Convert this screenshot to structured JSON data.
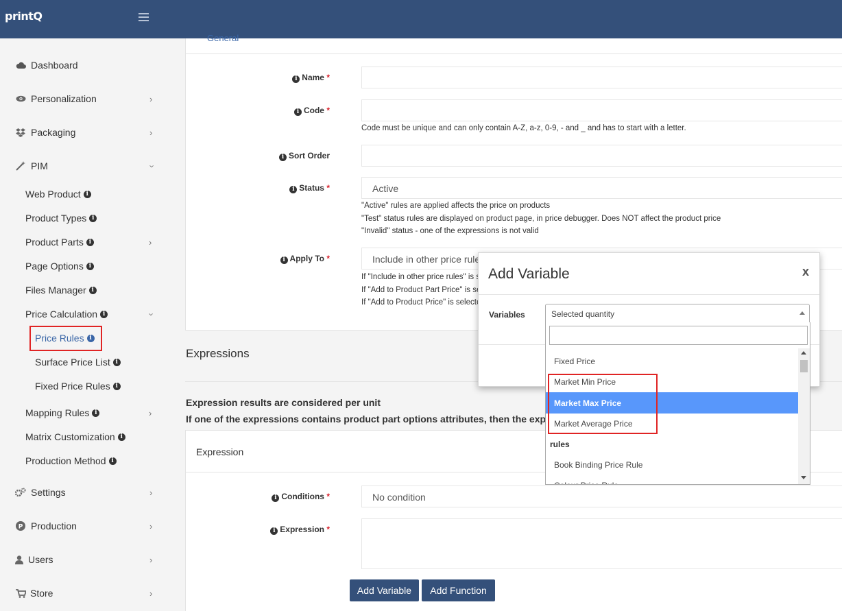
{
  "app": {
    "logo": "printQ"
  },
  "sidebar": {
    "items": [
      {
        "label": "Dashboard",
        "icon": "cloud-icon"
      },
      {
        "label": "Personalization",
        "icon": "eye-icon"
      },
      {
        "label": "Packaging",
        "icon": "dropbox-icon"
      },
      {
        "label": "PIM",
        "icon": "magic-wand-icon"
      },
      {
        "label": "Settings",
        "icon": "gears-icon"
      },
      {
        "label": "Production",
        "icon": "p-circle-icon"
      },
      {
        "label": "Users",
        "icon": "user-icon"
      },
      {
        "label": "Store",
        "icon": "cart-icon"
      }
    ],
    "pim_sub": [
      {
        "label": "Web Product"
      },
      {
        "label": "Product Types"
      },
      {
        "label": "Product Parts"
      },
      {
        "label": "Page Options"
      },
      {
        "label": "Files Manager"
      },
      {
        "label": "Price Calculation"
      },
      {
        "label": "Mapping Rules"
      },
      {
        "label": "Matrix Customization"
      },
      {
        "label": "Production Method"
      }
    ],
    "price_sub": [
      {
        "label": "Price Rules"
      },
      {
        "label": "Surface Price List"
      },
      {
        "label": "Fixed Price Rules"
      }
    ]
  },
  "form": {
    "tab_general": "General",
    "name_label": "Name",
    "code_label": "Code",
    "code_help": "Code must be unique and can only contain A-Z, a-z, 0-9, - and _ and has to start with a letter.",
    "sort_order_label": "Sort Order",
    "status_label": "Status",
    "status_value": "Active",
    "status_help": [
      "\"Active\" rules are applied affects the price on products",
      "\"Test\" status rules are displayed on product page, in price debugger. Does NOT affect the product price",
      "\"Invalid\" status - one of the expressions is not valid"
    ],
    "apply_to_label": "Apply To",
    "apply_to_value": "Include in other price rules",
    "apply_help": [
      "If \"Include in other price rules\" is se",
      "If \"Add to Product Part Price\" is sel",
      "If \"Add to Product Price\" is selected"
    ],
    "required_mark": "*"
  },
  "expressions": {
    "title": "Expressions",
    "note1": "Expression results are considered per unit",
    "note2": "If one of the expressions contains product part options attributes, then the express",
    "expression_header": "Expression",
    "conditions_label": "Conditions",
    "conditions_value": "No condition",
    "expression_label": "Expression",
    "add_variable_button": "Add Variable",
    "add_function_button": "Add Function"
  },
  "modal": {
    "title": "Add Variable",
    "close": "x",
    "variables_label": "Variables",
    "selected": "Selected quantity",
    "options": [
      {
        "label": "Fixed Price",
        "type": "option"
      },
      {
        "label": "Market Min Price",
        "type": "option"
      },
      {
        "label": "Market Max Price",
        "type": "option",
        "highlighted": true
      },
      {
        "label": "Market Average Price",
        "type": "option"
      },
      {
        "label": "rules",
        "type": "group"
      },
      {
        "label": "Book Binding Price Rule",
        "type": "option"
      },
      {
        "label": "Colour Price Rule",
        "type": "option"
      }
    ]
  },
  "colors": {
    "header_bg": "#34507a",
    "highlight": "#5897fb",
    "annotation_red": "#e02424",
    "link_blue": "#3a66a7"
  }
}
